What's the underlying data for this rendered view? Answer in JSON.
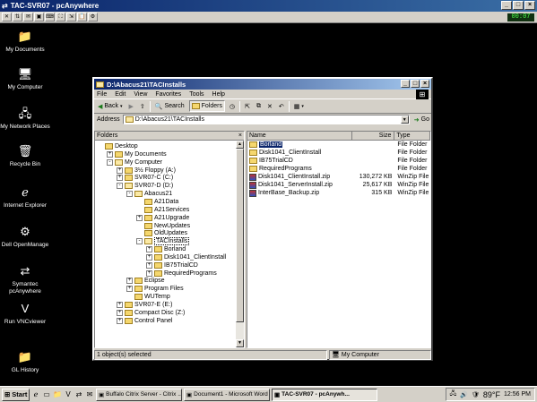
{
  "outer": {
    "title": "TAC-SVR07 - pcAnywhere",
    "clock_display": "00:07"
  },
  "desktop_icons": [
    {
      "label": "My Documents",
      "icon": "my-documents-icon",
      "glyph": "📁"
    },
    {
      "label": "My Computer",
      "icon": "my-computer-icon",
      "glyph": "🖥"
    },
    {
      "label": "My Network Places",
      "icon": "network-places-icon",
      "glyph": "🖧"
    },
    {
      "label": "Recycle Bin",
      "icon": "recycle-bin-icon",
      "glyph": "🗑"
    },
    {
      "label": "Internet Explorer",
      "icon": "internet-explorer-icon",
      "glyph": "ℯ"
    },
    {
      "label": "Dell OpenManage",
      "icon": "dell-openmanage-icon",
      "glyph": "⚙"
    },
    {
      "label": "Symantec pcAnywhere",
      "icon": "pcanywhere-icon",
      "glyph": "⇄"
    },
    {
      "label": "Run VNCviewer",
      "icon": "vncviewer-icon",
      "glyph": "V"
    },
    {
      "label": "GL History",
      "icon": "gl-history-icon",
      "glyph": "📁"
    }
  ],
  "window": {
    "title": "D:\\Abacus21\\TACInstalls",
    "menu": [
      "File",
      "Edit",
      "View",
      "Favorites",
      "Tools",
      "Help"
    ],
    "toolbar": {
      "back": "Back",
      "search": "Search",
      "folders": "Folders"
    },
    "address_label": "Address",
    "address_value": "D:\\Abacus21\\TACInstalls",
    "go": "Go",
    "folders_header": "Folders",
    "tree": [
      {
        "label": "Desktop",
        "level": 0,
        "pm": ""
      },
      {
        "label": "My Documents",
        "level": 1,
        "pm": "+"
      },
      {
        "label": "My Computer",
        "level": 1,
        "pm": "-"
      },
      {
        "label": "3½ Floppy (A:)",
        "level": 2,
        "pm": "+"
      },
      {
        "label": "SVR07-C (C:)",
        "level": 2,
        "pm": "+"
      },
      {
        "label": "SVR07-D (D:)",
        "level": 2,
        "pm": "-"
      },
      {
        "label": "Abacus21",
        "level": 3,
        "pm": "-"
      },
      {
        "label": "A21Data",
        "level": 4,
        "pm": ""
      },
      {
        "label": "A21Services",
        "level": 4,
        "pm": ""
      },
      {
        "label": "A21Upgrade",
        "level": 4,
        "pm": "+"
      },
      {
        "label": "NewUpdates",
        "level": 4,
        "pm": ""
      },
      {
        "label": "OldUpdates",
        "level": 4,
        "pm": ""
      },
      {
        "label": "TACInstalls",
        "level": 4,
        "pm": "-"
      },
      {
        "label": "Borland",
        "level": 5,
        "pm": "+"
      },
      {
        "label": "Disk1041_ClientInstall",
        "level": 5,
        "pm": "+"
      },
      {
        "label": "IB75TrialCD",
        "level": 5,
        "pm": "+"
      },
      {
        "label": "RequiredPrograms",
        "level": 5,
        "pm": "+"
      },
      {
        "label": "Eclipse",
        "level": 3,
        "pm": "+"
      },
      {
        "label": "Program Files",
        "level": 3,
        "pm": "+"
      },
      {
        "label": "WUTemp",
        "level": 3,
        "pm": ""
      },
      {
        "label": "SVR07-E (E:)",
        "level": 2,
        "pm": "+"
      },
      {
        "label": "Compact Disc (Z:)",
        "level": 2,
        "pm": "+"
      },
      {
        "label": "Control Panel",
        "level": 2,
        "pm": "+"
      }
    ],
    "list_headers": {
      "name": "Name",
      "size": "Size",
      "type": "Type"
    },
    "files": [
      {
        "name": "Borland",
        "size": "",
        "type": "File Folder",
        "kind": "folder"
      },
      {
        "name": "Disk1041_ClientInstall",
        "size": "",
        "type": "File Folder",
        "kind": "folder"
      },
      {
        "name": "IB75TrialCD",
        "size": "",
        "type": "File Folder",
        "kind": "folder"
      },
      {
        "name": "RequiredPrograms",
        "size": "",
        "type": "File Folder",
        "kind": "folder"
      },
      {
        "name": "Disk1041_ClientInstall.zip",
        "size": "130,272 KB",
        "type": "WinZip File",
        "kind": "zip"
      },
      {
        "name": "Disk1041_ServerInstall.zip",
        "size": "25,617 KB",
        "type": "WinZip File",
        "kind": "zip"
      },
      {
        "name": "InterBase_Backup.zip",
        "size": "315 KB",
        "type": "WinZip File",
        "kind": "zip"
      }
    ],
    "status_left": "1 object(s) selected",
    "status_right": "My Computer"
  },
  "taskbar": {
    "start": "Start",
    "tasks": [
      {
        "label": "Buffalo Citrix Server - Citrix ...",
        "active": false
      },
      {
        "label": "Document1 - Microsoft Word",
        "active": false
      },
      {
        "label": "TAC-SVR07 - pcAnywh...",
        "active": true
      }
    ],
    "temp": "89°F",
    "time": "12:56 PM"
  }
}
